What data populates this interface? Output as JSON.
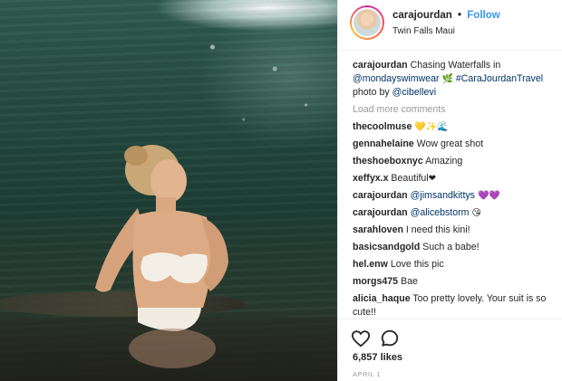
{
  "post": {
    "photo_alt": "photo",
    "header": {
      "username": "carajourdan",
      "separator": "•",
      "follow_label": "Follow",
      "location": "Twin Falls Maui"
    },
    "caption": {
      "username": "carajourdan",
      "text_1": "Chasing Waterfalls in",
      "mention_1": "@mondayswimwear",
      "emoji_1": "🌿",
      "hashtag": "#CaraJourdanTravel",
      "text_2": "photo by",
      "mention_2": "@cibellevi"
    },
    "load_more_label": "Load more comments",
    "comments": [
      {
        "username": "thecoolmuse",
        "text": "",
        "emoji": "💛✨🌊"
      },
      {
        "username": "gennahelaine",
        "text": "Wow great shot",
        "emoji": ""
      },
      {
        "username": "theshoeboxnyc",
        "text": "Amazing",
        "emoji": ""
      },
      {
        "username": "xeffyx.x",
        "text": "Beautiful",
        "emoji": "❤"
      },
      {
        "username": "carajourdan",
        "mention": "@jimsandkittys",
        "emoji": "💜💜"
      },
      {
        "username": "carajourdan",
        "mention": "@alicebstorm",
        "emoji": "😘"
      },
      {
        "username": "sarahloven",
        "text": "I need this kini!",
        "emoji": ""
      },
      {
        "username": "basicsandgold",
        "text": "Such a babe!",
        "emoji": ""
      },
      {
        "username": "hel.enw",
        "text": "Love this pic",
        "emoji": ""
      },
      {
        "username": "morgs475",
        "text": "Bae",
        "emoji": ""
      },
      {
        "username": "alicia_haque",
        "text": "Too pretty lovely. Your suit is so cute!!",
        "emoji": ""
      }
    ],
    "actions": {
      "like_icon": "heart-icon",
      "comment_icon": "comment-bubble-icon"
    },
    "likes_label": "6,857 likes",
    "date_label": "APRIL 1"
  },
  "colors": {
    "link": "#003569",
    "follow": "#3897f0",
    "muted": "#999999",
    "text": "#262626"
  }
}
